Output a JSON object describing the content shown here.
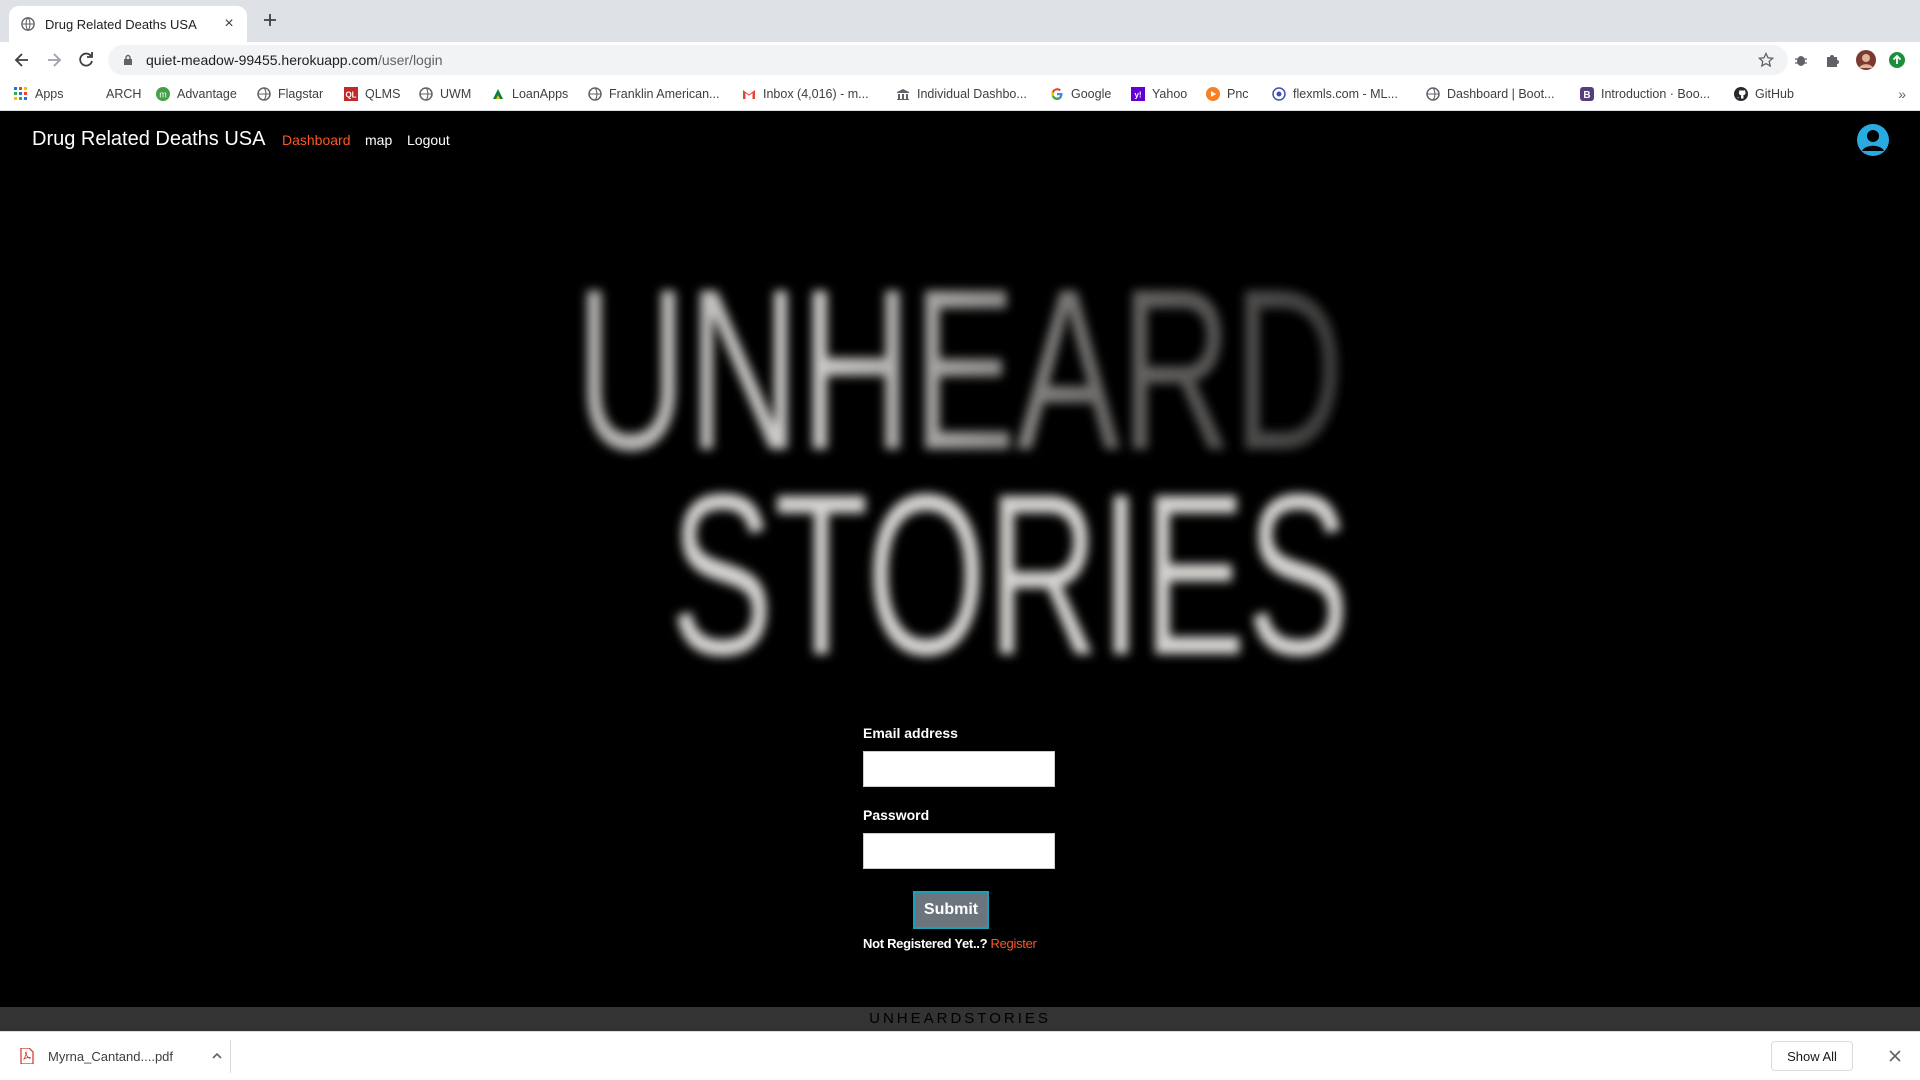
{
  "browser": {
    "tab_title": "Drug Related Deaths USA",
    "url_host": "quiet-meadow-99455.herokuapp.com",
    "url_path": "/user/login",
    "bookmarks": [
      {
        "label": "Apps",
        "icon": "apps-grid-icon"
      },
      {
        "label": "ARCH",
        "icon": ""
      },
      {
        "label": "Advantage",
        "icon": "advantage-icon"
      },
      {
        "label": "Flagstar",
        "icon": "globe-icon"
      },
      {
        "label": "QLMS",
        "icon": "ql-icon"
      },
      {
        "label": "UWM",
        "icon": "globe-icon"
      },
      {
        "label": "LoanApps",
        "icon": "loanapps-icon"
      },
      {
        "label": "Franklin American...",
        "icon": "globe-icon"
      },
      {
        "label": "Inbox (4,016) - m...",
        "icon": "gmail-icon"
      },
      {
        "label": "Individual Dashbo...",
        "icon": "building-icon"
      },
      {
        "label": "Google",
        "icon": "google-icon"
      },
      {
        "label": "Yahoo",
        "icon": "yahoo-icon"
      },
      {
        "label": "Pnc",
        "icon": "pnc-icon"
      },
      {
        "label": "flexmls.com - ML...",
        "icon": "flexmls-icon"
      },
      {
        "label": "Dashboard | Boot...",
        "icon": "globe-icon"
      },
      {
        "label": "Introduction · Boo...",
        "icon": "bootstrap-icon"
      },
      {
        "label": "GitHub",
        "icon": "github-icon"
      }
    ]
  },
  "app": {
    "brand": "Drug Related Deaths USA",
    "nav": {
      "dashboard": "Dashboard",
      "map": "map",
      "logout": "Logout"
    },
    "hero": {
      "line1": "UNHEARD",
      "line2": "STORIES"
    },
    "form": {
      "email_label": "Email address",
      "email_value": "",
      "password_label": "Password",
      "password_value": "",
      "submit": "Submit",
      "register_prompt": "Not Registered Yet..?",
      "register_link": "Register"
    },
    "footer": "UNHEARDSTORIES"
  },
  "downloads": {
    "file_name": "Myrna_Cantand....pdf",
    "show_all": "Show All"
  },
  "colors": {
    "accent": "#ff5722",
    "background": "#000000",
    "footer": "#333333",
    "submit_bg": "#6c757d",
    "avatar": "#29abe2"
  }
}
